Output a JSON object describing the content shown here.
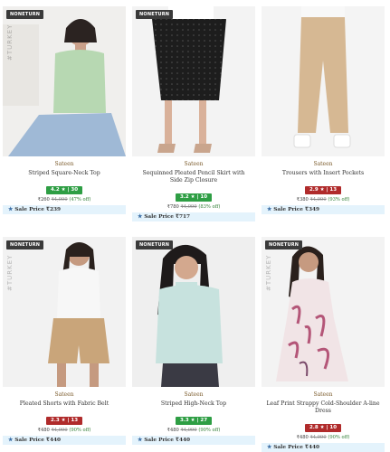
{
  "products": [
    {
      "badge": "NONETURN",
      "watermark": "#TURKEY",
      "brand": "Sateen",
      "title": "Striped Square-Neck Top",
      "rating": "4.2 ★ | 30",
      "rating_color": "#2e9e44",
      "price": "₹260",
      "mrp": "₹4,999",
      "discount": "(47% off)",
      "sale_label": "Sale Price ₹239",
      "top_color": "#b7d8b2",
      "bottom_color": "#9fb9d6"
    },
    {
      "badge": "NONETURN",
      "watermark": "",
      "brand": "Sateen",
      "title": "Sequinned Pleated Pencil Skirt with Side Zip Closure",
      "rating": "3.2 ★ | 10",
      "rating_color": "#2e9e44",
      "price": "₹780",
      "mrp": "₹4,999",
      "discount": "(83% off)",
      "sale_label": "Sale Price ₹717",
      "top_color": "#ffffff",
      "bottom_color": "#1d1d1d"
    },
    {
      "badge": "",
      "watermark": "",
      "brand": "Sateen",
      "title": "Trousers with Insert Pockets",
      "rating": "2.9 ★ | 13",
      "rating_color": "#b02b2b",
      "price": "₹380",
      "mrp": "₹4,999",
      "discount": "(93% off)",
      "sale_label": "Sale Price ₹349",
      "top_color": "#f3f3f3",
      "bottom_color": "#d6b893"
    },
    {
      "badge": "NONETURN",
      "watermark": "#TURKEY",
      "brand": "Sateen",
      "title": "Pleated Shorts with Fabric Belt",
      "rating": "2.3 ★ | 13",
      "rating_color": "#b02b2b",
      "price": "₹480",
      "mrp": "₹4,999",
      "discount": "(90% off)",
      "sale_label": "Sale Price ₹440",
      "top_color": "#f7f7f7",
      "bottom_color": "#c9a57a"
    },
    {
      "badge": "NONETURN",
      "watermark": "",
      "brand": "Sateen",
      "title": "Striped High-Neck Top",
      "rating": "3.3 ★ | 27",
      "rating_color": "#2e9e44",
      "price": "₹480",
      "mrp": "₹4,999",
      "discount": "(90% off)",
      "sale_label": "Sale Price ₹440",
      "top_color": "#c7e2de",
      "bottom_color": "#3a3a44"
    },
    {
      "badge": "NONETURN",
      "watermark": "#TURKEY",
      "brand": "Sateen",
      "title": "Leaf Print Strappy Cold-Shoulder A-line Dress",
      "rating": "2.8 ★ | 10",
      "rating_color": "#b02b2b",
      "price": "₹480",
      "mrp": "₹4,999",
      "discount": "(90% off)",
      "sale_label": "Sale Price ₹440",
      "top_color": "#f1e4e6",
      "bottom_color": "#f1e4e6"
    }
  ]
}
